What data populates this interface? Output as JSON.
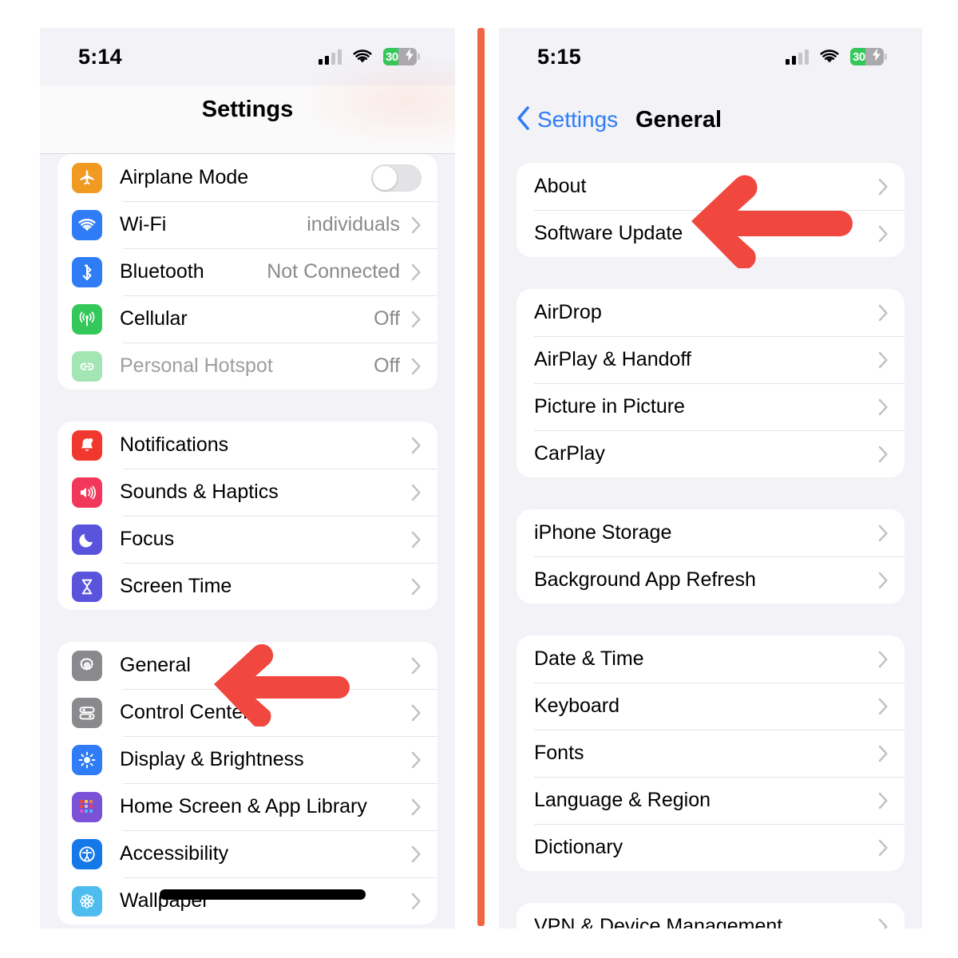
{
  "divider_color": "#F26543",
  "arrow_color": "#F0473E",
  "accent_blue": "#2F7CF6",
  "list_bg": "#F2F2F7",
  "left_phone": {
    "status_bar": {
      "time": "5:14",
      "signal_icon": "cellular-signal-icon",
      "wifi_icon": "wifi-icon",
      "battery_level": "30",
      "battery_icon": "battery-charging-icon"
    },
    "nav": {
      "title": "Settings"
    },
    "groups": [
      {
        "name": "connectivity",
        "rows": [
          {
            "label": "Airplane Mode",
            "icon": "airplane-icon",
            "icon_color": "#F09A22",
            "control": "switch",
            "switch_on": false
          },
          {
            "label": "Wi-Fi",
            "icon": "wifi-icon",
            "icon_color": "#2F7CF6",
            "value": "individuals",
            "control": "chevron"
          },
          {
            "label": "Bluetooth",
            "icon": "bluetooth-icon",
            "icon_color": "#2F7CF6",
            "value": "Not Connected",
            "control": "chevron"
          },
          {
            "label": "Cellular",
            "icon": "cellular-antenna-icon",
            "icon_color": "#34C759",
            "value": "Off",
            "control": "chevron"
          },
          {
            "label": "Personal Hotspot",
            "icon": "hotspot-link-icon",
            "icon_color": "#34C759",
            "value": "Off",
            "control": "chevron",
            "disabled": true
          }
        ]
      },
      {
        "name": "notifications",
        "rows": [
          {
            "label": "Notifications",
            "icon": "bell-icon",
            "icon_color": "#F0382E",
            "control": "chevron"
          },
          {
            "label": "Sounds & Haptics",
            "icon": "speaker-icon",
            "icon_color": "#F2385A",
            "control": "chevron"
          },
          {
            "label": "Focus",
            "icon": "moon-icon",
            "icon_color": "#5A54DC",
            "control": "chevron"
          },
          {
            "label": "Screen Time",
            "icon": "hourglass-icon",
            "icon_color": "#5A54DC",
            "control": "chevron"
          }
        ]
      },
      {
        "name": "system",
        "rows": [
          {
            "label": "General",
            "icon": "gear-icon",
            "icon_color": "#8A8A8E",
            "control": "chevron"
          },
          {
            "label": "Control Center",
            "icon": "sliders-icon",
            "icon_color": "#8A8A8E",
            "control": "chevron"
          },
          {
            "label": "Display & Brightness",
            "icon": "brightness-icon",
            "icon_color": "#2F7CF6",
            "control": "chevron"
          },
          {
            "label": "Home Screen & App Library",
            "icon": "app-grid-icon",
            "icon_color": "#7B52D6",
            "control": "chevron"
          },
          {
            "label": "Accessibility",
            "icon": "accessibility-icon",
            "icon_color": "#1478E8",
            "control": "chevron"
          },
          {
            "label": "Wallpaper",
            "icon": "flower-icon",
            "icon_color": "#4FBCF0",
            "control": "chevron"
          }
        ]
      }
    ],
    "annotation": {
      "arrow": "left-pointing-arrow",
      "points_at": "General"
    }
  },
  "right_phone": {
    "status_bar": {
      "time": "5:15",
      "signal_icon": "cellular-signal-icon",
      "wifi_icon": "wifi-icon",
      "battery_level": "30",
      "battery_icon": "battery-charging-icon"
    },
    "nav": {
      "back_label": "Settings",
      "back_icon": "chevron-left-icon",
      "title": "General"
    },
    "groups": [
      {
        "name": "about-update",
        "rows": [
          {
            "label": "About",
            "control": "chevron"
          },
          {
            "label": "Software Update",
            "control": "chevron"
          }
        ]
      },
      {
        "name": "sharing",
        "rows": [
          {
            "label": "AirDrop",
            "control": "chevron"
          },
          {
            "label": "AirPlay & Handoff",
            "control": "chevron"
          },
          {
            "label": "Picture in Picture",
            "control": "chevron"
          },
          {
            "label": "CarPlay",
            "control": "chevron"
          }
        ]
      },
      {
        "name": "storage",
        "rows": [
          {
            "label": "iPhone Storage",
            "control": "chevron"
          },
          {
            "label": "Background App Refresh",
            "control": "chevron"
          }
        ]
      },
      {
        "name": "localization",
        "rows": [
          {
            "label": "Date & Time",
            "control": "chevron"
          },
          {
            "label": "Keyboard",
            "control": "chevron"
          },
          {
            "label": "Fonts",
            "control": "chevron"
          },
          {
            "label": "Language & Region",
            "control": "chevron"
          },
          {
            "label": "Dictionary",
            "control": "chevron"
          }
        ]
      },
      {
        "name": "device-management",
        "rows": [
          {
            "label": "VPN & Device Management",
            "control": "chevron"
          }
        ]
      }
    ],
    "annotation": {
      "arrow": "left-pointing-arrow",
      "points_at": "Software Update"
    }
  }
}
